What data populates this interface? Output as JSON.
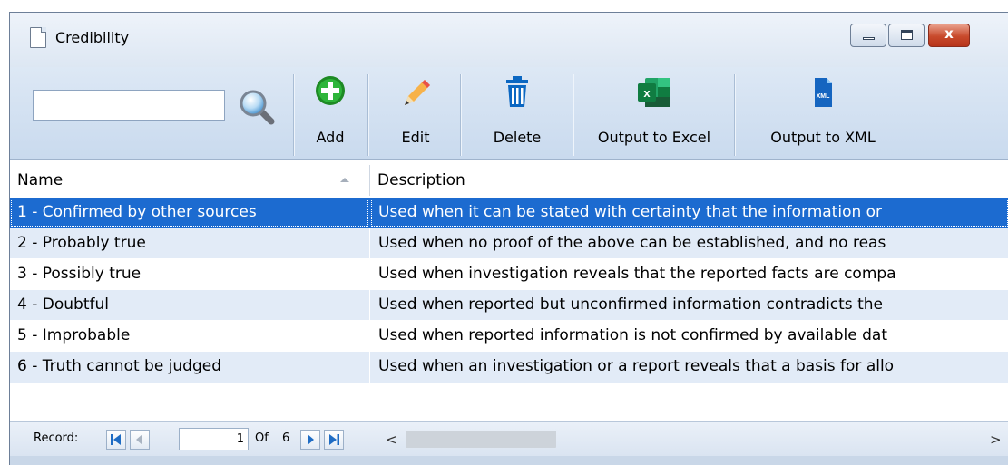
{
  "window": {
    "title": "Credibility",
    "close_glyph": "x"
  },
  "toolbar": {
    "search_value": "",
    "buttons": [
      {
        "label": "Add",
        "icon": "add-icon"
      },
      {
        "label": "Edit",
        "icon": "pencil-icon"
      },
      {
        "label": "Delete",
        "icon": "trash-icon"
      },
      {
        "label": "Output to Excel",
        "icon": "excel-icon"
      },
      {
        "label": "Output to XML",
        "icon": "xml-file-icon"
      }
    ]
  },
  "grid": {
    "columns": [
      {
        "header": "Name",
        "sort": "ascending"
      },
      {
        "header": "Description"
      }
    ],
    "rows": [
      {
        "name": "1 - Confirmed by other sources",
        "description": "Used when it can be stated with certainty that the information or",
        "selected": true
      },
      {
        "name": "2 - Probably true",
        "description": "Used when no proof of the above can be established, and no reas"
      },
      {
        "name": "3 - Possibly true",
        "description": "Used when investigation reveals that the reported facts are compa"
      },
      {
        "name": "4 - Doubtful",
        "description": "Used when reported but unconfirmed information contradicts the"
      },
      {
        "name": "5 - Improbable",
        "description": "Used when reported information is not confirmed by available dat"
      },
      {
        "name": "6 - Truth cannot be judged",
        "description": "Used when an investigation or a report reveals that a basis for allo"
      }
    ]
  },
  "navigator": {
    "record_label": "Record:",
    "current": "1",
    "of_label": "Of",
    "total": "6",
    "scroll_left": "<",
    "scroll_right": ">"
  },
  "colors": {
    "selection": "#1c6bd0",
    "alt_row": "#e2ebf7",
    "toolbar_bg": "#d3e1f1"
  }
}
